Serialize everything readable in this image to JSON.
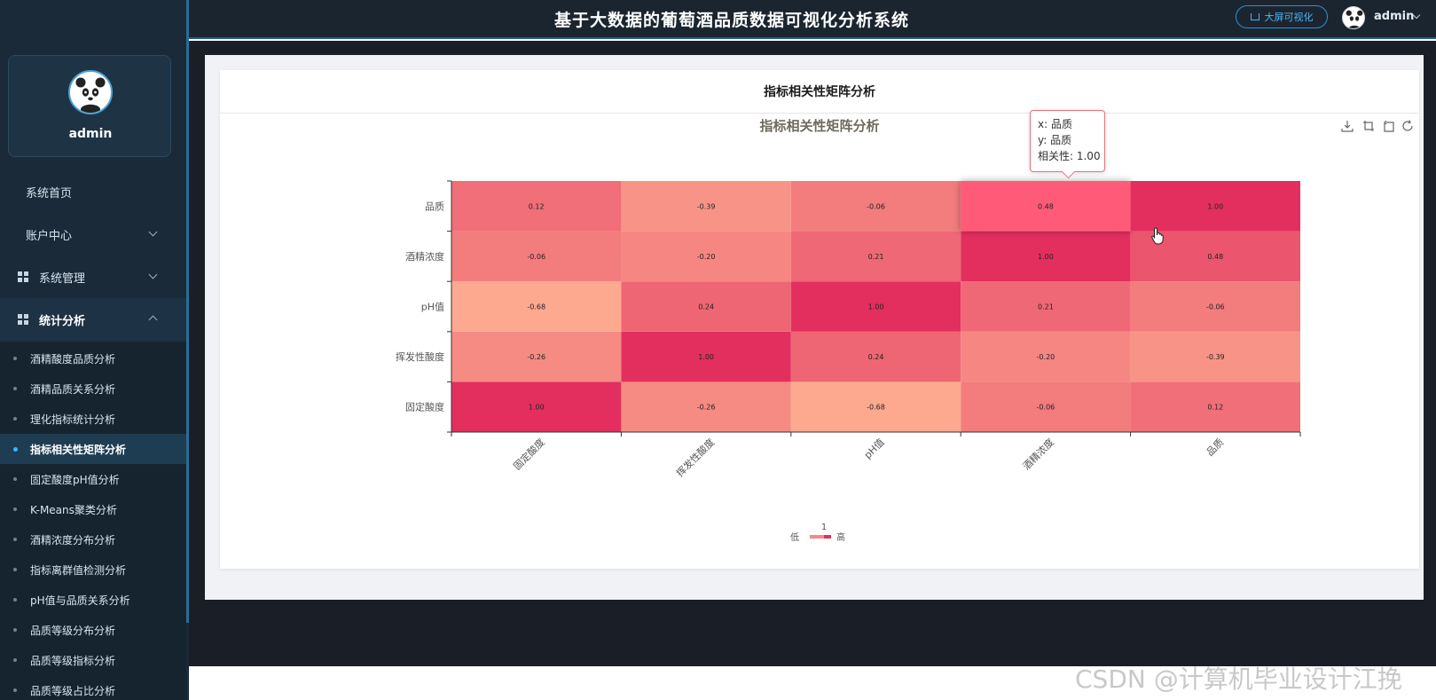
{
  "header": {
    "title": "基于大数据的葡萄酒品质数据可视化分析系统",
    "big_screen_label": "大屏可视化",
    "username": "admin"
  },
  "sidebar": {
    "profile_name": "admin",
    "menu": [
      {
        "label": "系统首页"
      },
      {
        "label": "账户中心"
      },
      {
        "label": "系统管理"
      },
      {
        "label": "统计分析"
      }
    ],
    "submenu": [
      {
        "label": "酒精酸度品质分析"
      },
      {
        "label": "酒精品质关系分析"
      },
      {
        "label": "理化指标统计分析"
      },
      {
        "label": "指标相关性矩阵分析"
      },
      {
        "label": "固定酸度pH值分析"
      },
      {
        "label": "K-Means聚类分析"
      },
      {
        "label": "酒精浓度分布分析"
      },
      {
        "label": "指标离群值检测分析"
      },
      {
        "label": "pH值与品质关系分析"
      },
      {
        "label": "品质等级分布分析"
      },
      {
        "label": "品质等级指标分析"
      },
      {
        "label": "品质等级占比分析"
      }
    ],
    "active_submenu": "指标相关性矩阵分析"
  },
  "card": {
    "title": "指标相关性矩阵分析"
  },
  "tooltip": {
    "x_line": "x: 品质",
    "y_line": "y: 品质",
    "value_line": "相关性: 1.00"
  },
  "icons": [
    "download-icon",
    "zoom-icon",
    "zoom-reset-icon",
    "restore-icon",
    "grid-icon",
    "cart-icon",
    "hand-cursor-icon"
  ],
  "colors": {
    "sidebar_bg": "#1a2a38",
    "accent": "#3fb3ff",
    "heat_low": "#fca98f",
    "heat_high": "#e32f5e"
  },
  "chart_data": {
    "type": "heatmap",
    "title": "指标相关性矩阵分析",
    "x_categories": [
      "固定酸度",
      "挥发性酸度",
      "pH值",
      "酒精浓度",
      "品质"
    ],
    "y_categories": [
      "固定酸度",
      "挥发性酸度",
      "pH值",
      "酒精浓度",
      "品质"
    ],
    "values": [
      [
        1.0,
        -0.26,
        -0.68,
        -0.06,
        0.12
      ],
      [
        -0.26,
        1.0,
        0.24,
        -0.2,
        -0.39
      ],
      [
        -0.68,
        0.24,
        1.0,
        0.21,
        -0.06
      ],
      [
        -0.06,
        -0.2,
        0.21,
        1.0,
        0.48
      ],
      [
        0.12,
        -0.39,
        -0.06,
        0.48,
        1.0
      ]
    ],
    "visual_map": {
      "min_label": "低",
      "max_label": "高",
      "top_value": "1"
    },
    "highlighted_cell": {
      "x": "酒精浓度",
      "y": "品质"
    }
  },
  "watermark": "CSDN @计算机毕业设计江挽"
}
